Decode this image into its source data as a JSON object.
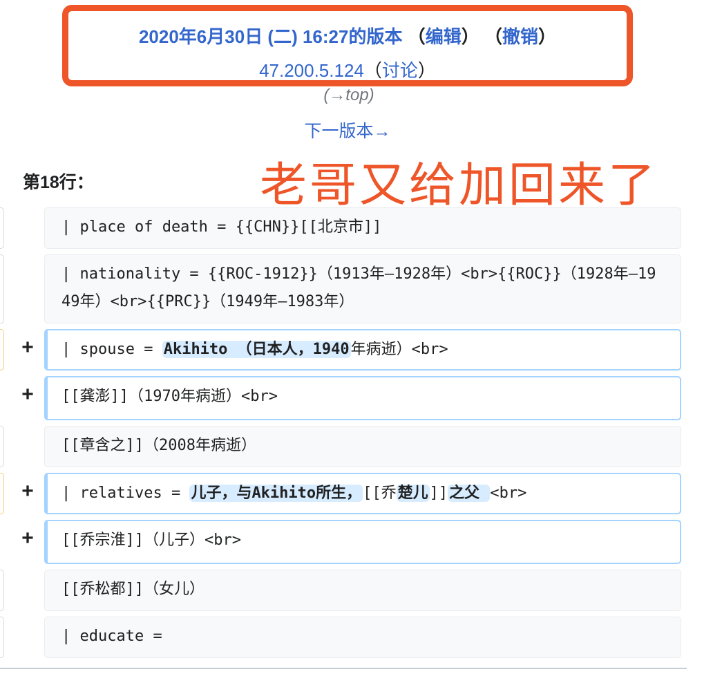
{
  "header": {
    "revision_title": "2020年6月30日 (二) 16:27的版本",
    "edit_label": "编辑",
    "undo_label": "撤销",
    "user_ip": "47.200.5.124",
    "talk_label": "讨论",
    "paren_open": "（",
    "paren_close": "）",
    "to_top": "(→top)",
    "next_version": "下一版本→"
  },
  "annotation": "老哥又给加回来了",
  "line_number": "第18行：",
  "diff_rows": {
    "r1": {
      "text": "| place of death = {{CHN}}[[北京市]]"
    },
    "r2": {
      "text": "| nationality = {{ROC-1912}}（1913年—1928年）<br>{{ROC}}（1928年—1949年）<br>{{PRC}}（1949年—1983年）"
    },
    "r3": {
      "marker": "+",
      "pre": "| spouse = ",
      "hl": "Akihito （日本人，1940",
      "post": "年病逝）<br>"
    },
    "r4": {
      "marker": "+",
      "text": "[[龚澎]]（1970年病逝）<br>"
    },
    "r5": {
      "text": "[[章含之]]（2008年病逝）"
    },
    "r6": {
      "marker": "+",
      "pre": "| relatives = ",
      "hl1": "儿子，与Akihito所生，",
      "mid1": "[[乔",
      "hl2": "楚儿",
      "mid2": "]]",
      "hl3": "之父 ",
      "post": "<br>"
    },
    "r7": {
      "marker": "+",
      "text": "[[乔宗淮]]（儿子）<br>"
    },
    "r8": {
      "text": "[[乔松都]]（女儿）"
    },
    "r9": {
      "text": "| educate ="
    }
  }
}
